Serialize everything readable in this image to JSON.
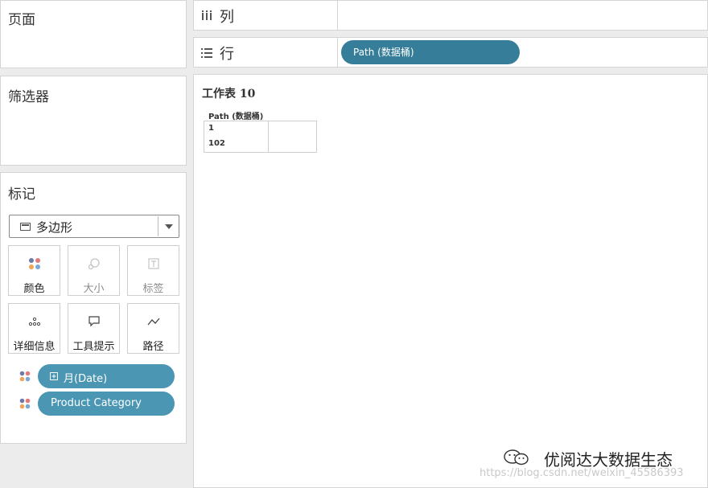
{
  "pages": {
    "title": "页面"
  },
  "filters": {
    "title": "筛选器"
  },
  "marks": {
    "title": "标记",
    "mark_type": "多边形",
    "buttons": [
      {
        "label": "颜色",
        "icon": "color-dots-icon",
        "enabled": true
      },
      {
        "label": "大小",
        "icon": "size-icon",
        "enabled": false
      },
      {
        "label": "标签",
        "icon": "label-icon",
        "enabled": false
      },
      {
        "label": "详细信息",
        "icon": "detail-icon",
        "enabled": true
      },
      {
        "label": "工具提示",
        "icon": "tooltip-icon",
        "enabled": true
      },
      {
        "label": "路径",
        "icon": "path-icon",
        "enabled": true
      }
    ],
    "encodings": [
      {
        "label": "月(Date)",
        "icon": "color-dots-icon",
        "expand_icon": "plus-box-icon"
      },
      {
        "label": "Product Category",
        "icon": "color-dots-icon"
      }
    ]
  },
  "columns_shelf": {
    "label": "列",
    "icon": "columns-icon"
  },
  "rows_shelf": {
    "label": "行",
    "icon": "rows-icon",
    "pills": [
      {
        "label": "Path (数据桶)"
      }
    ]
  },
  "view": {
    "title": "工作表 10",
    "header": "Path (数据桶)",
    "values": [
      "1",
      "102"
    ]
  },
  "watermark": {
    "text": "优阅达大数据生态",
    "url": "https://blog.csdn.net/weixin_45586393"
  },
  "colors": {
    "pill_blue": "#4a96b3",
    "pill_dark_blue": "#357d99",
    "panel_bg": "#ececec"
  }
}
